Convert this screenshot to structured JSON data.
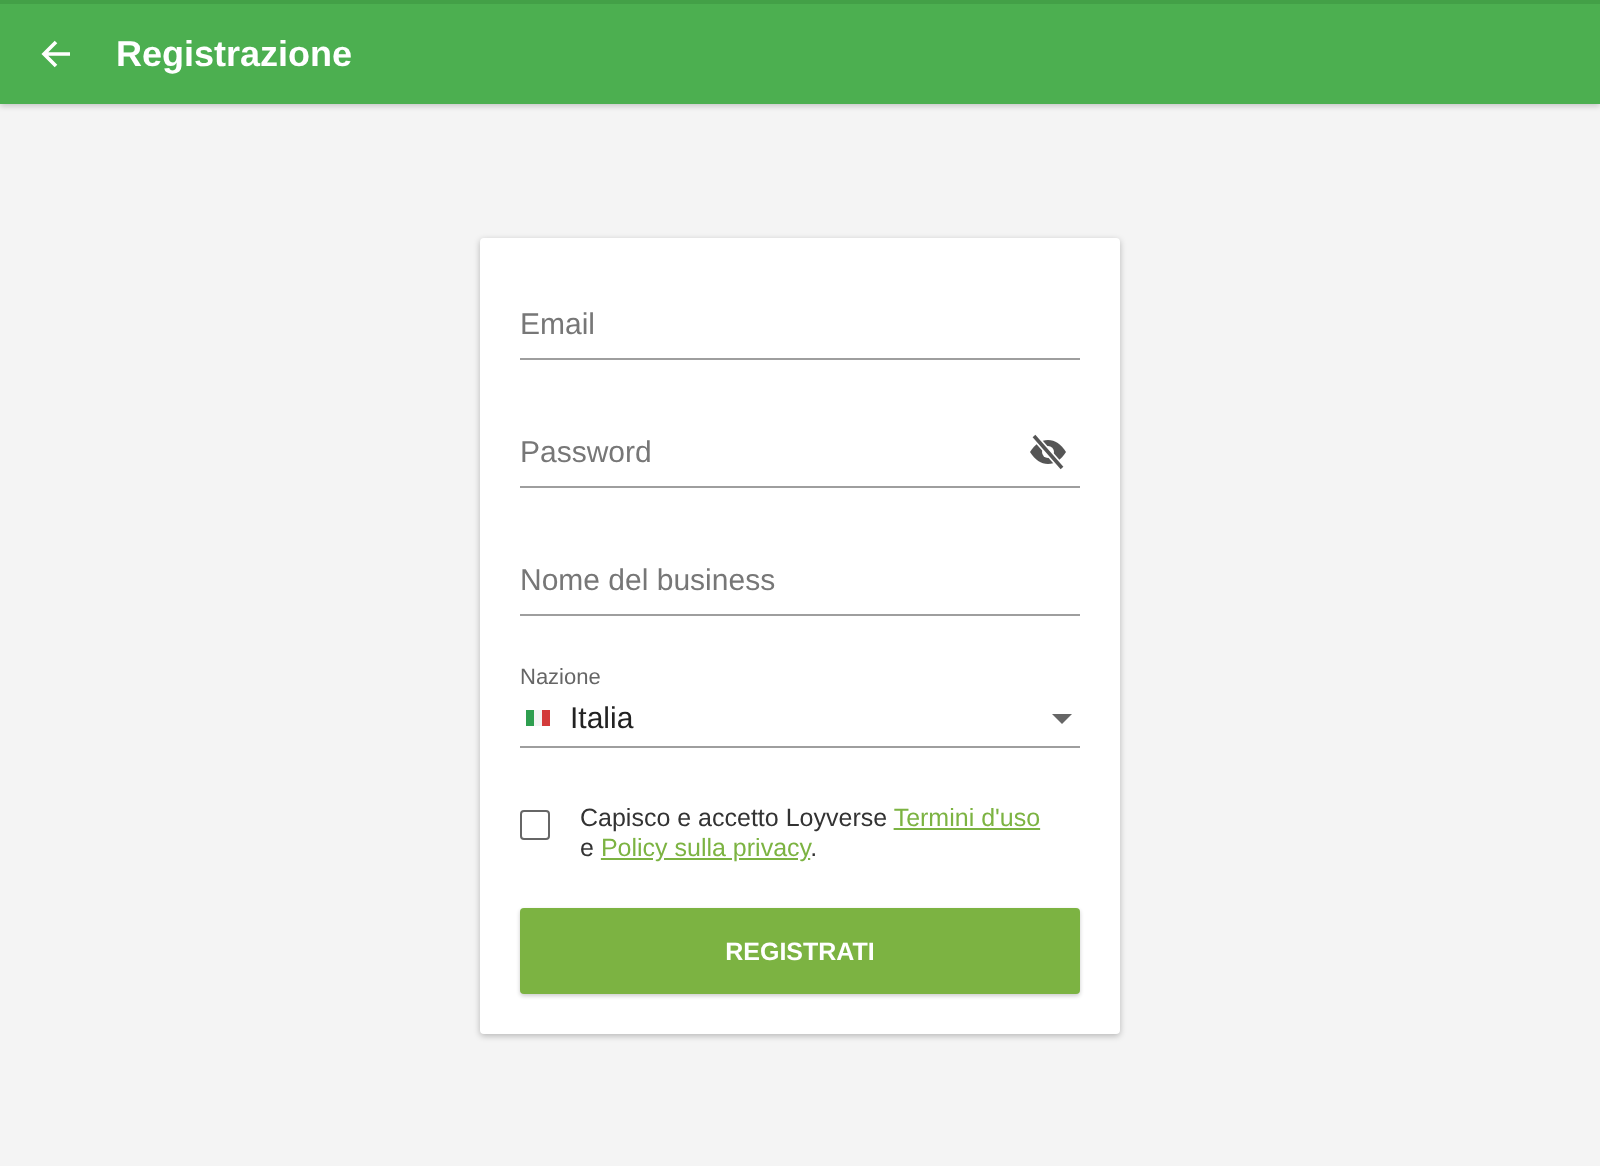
{
  "app_bar": {
    "title": "Registrazione"
  },
  "fields": [
    {
      "kind": "text",
      "placeholder": "Email"
    },
    {
      "kind": "password",
      "placeholder": "Password"
    },
    {
      "kind": "text",
      "placeholder": "Nome del business"
    },
    {
      "kind": "select",
      "label": "Nazione",
      "value": "Italia"
    }
  ],
  "consent": {
    "checked": false,
    "text_before": "Capisco e accetto Loyverse",
    "terms_link": "Termini d'uso",
    "joiner": "e",
    "privacy_link": "Policy sulla privacy",
    "text_after": "."
  },
  "submit_button": "REGISTRATI"
}
